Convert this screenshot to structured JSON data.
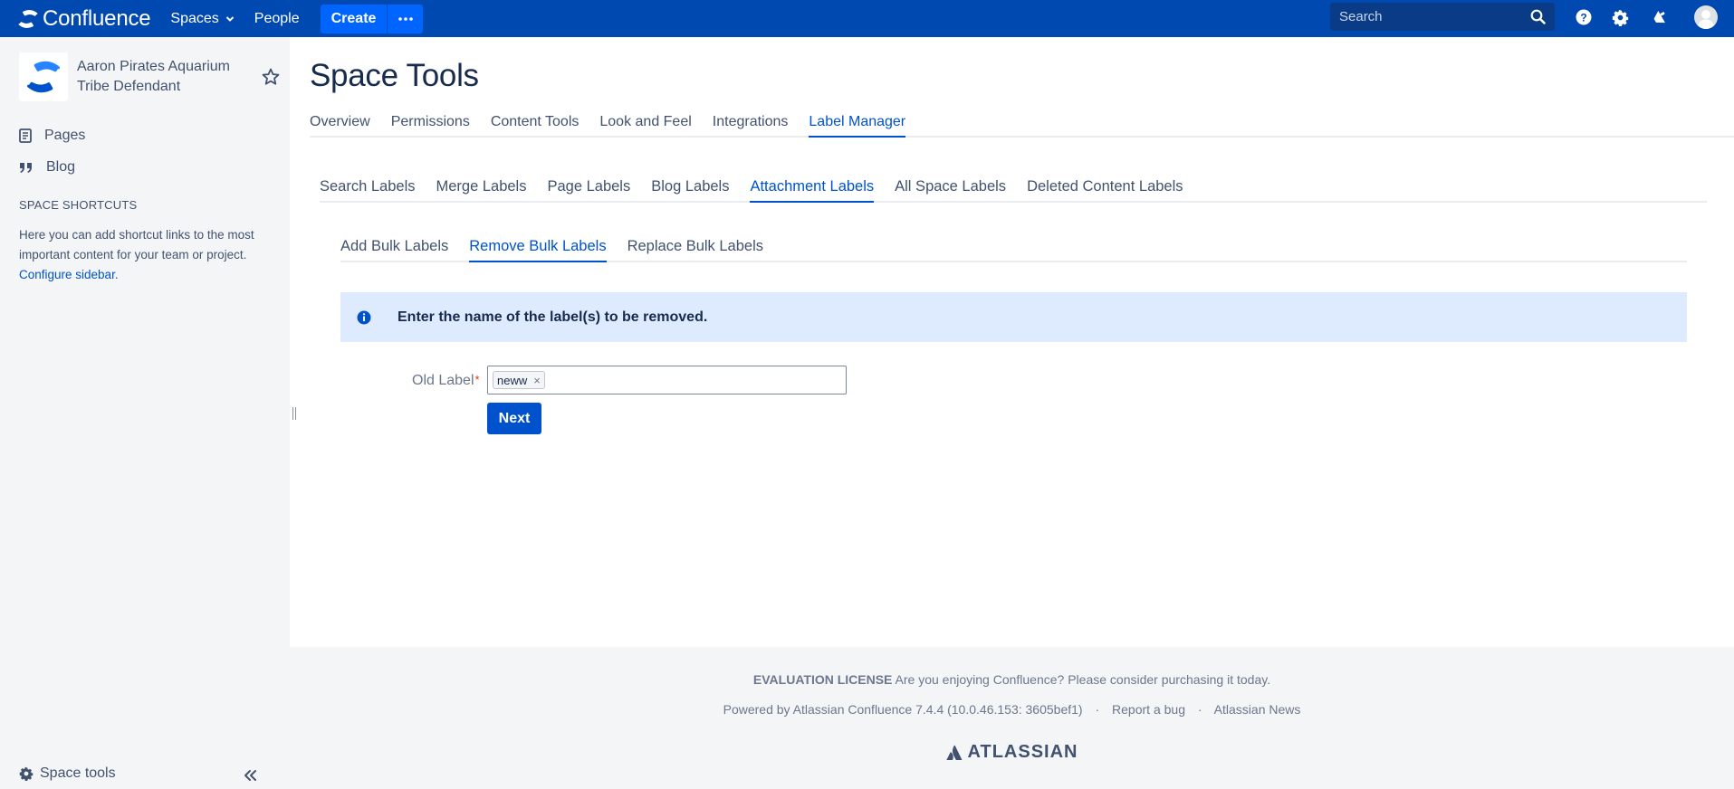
{
  "header": {
    "product_name": "Confluence",
    "spaces_label": "Spaces",
    "people_label": "People",
    "create_label": "Create",
    "search_placeholder": "Search",
    "brand_color": "#0049b0",
    "create_color": "#0065ff"
  },
  "sidebar": {
    "space_name": "Aaron Pirates Aquarium Tribe Defendant",
    "nav": [
      {
        "label": "Pages",
        "icon": "page-icon"
      },
      {
        "label": "Blog",
        "icon": "quote-icon"
      }
    ],
    "shortcuts_heading": "SPACE SHORTCUTS",
    "shortcuts_text": "Here you can add shortcut links to the most important content for your team or project.",
    "configure_link": "Configure sidebar",
    "configure_suffix": ".",
    "space_tools_label": "Space tools"
  },
  "main": {
    "title": "Space Tools",
    "tabs": [
      "Overview",
      "Permissions",
      "Content Tools",
      "Look and Feel",
      "Integrations",
      "Label Manager"
    ],
    "active_tab": "Label Manager",
    "sub_tabs": [
      "Search Labels",
      "Merge Labels",
      "Page Labels",
      "Blog Labels",
      "Attachment Labels",
      "All Space Labels",
      "Deleted Content Labels"
    ],
    "active_sub_tab": "Attachment Labels",
    "bulk_tabs": [
      "Add Bulk Labels",
      "Remove Bulk Labels",
      "Replace Bulk Labels"
    ],
    "active_bulk_tab": "Remove Bulk Labels",
    "info_message": "Enter the name of the label(s) to be removed.",
    "form": {
      "old_label_label": "Old Label",
      "required_mark": "*",
      "tags": [
        "neww"
      ],
      "tag_remove_glyph": "×",
      "next_label": "Next"
    }
  },
  "footer": {
    "license_bold": "EVALUATION LICENSE",
    "license_text": "Are you enjoying Confluence? Please consider purchasing it today.",
    "powered_by": "Powered by Atlassian Confluence 7.4.4 (10.0.46.153: 3605bef1)",
    "report_bug": "Report a bug",
    "news": "Atlassian News",
    "separator": "·",
    "atlassian_logo_text": "ATLASSIAN"
  }
}
